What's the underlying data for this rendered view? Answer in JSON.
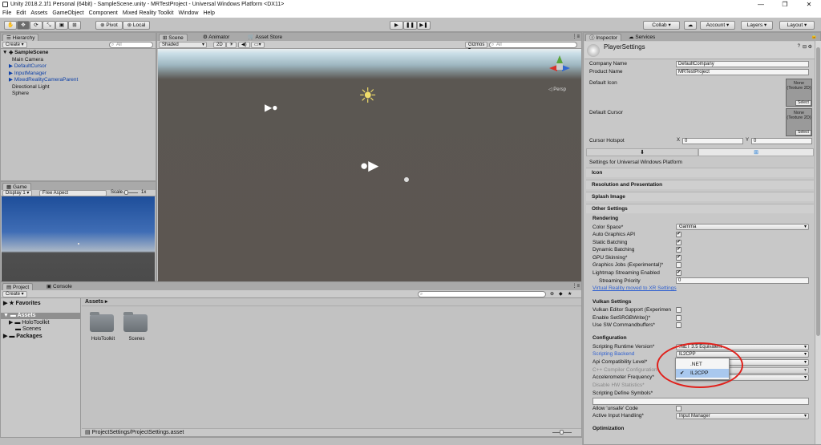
{
  "window": {
    "title": "Unity 2018.2.1f1 Personal (64bit) - SampleScene.unity - MRTestProject - Universal Windows Platform <DX11>",
    "minimize": "—",
    "maximize": "❐",
    "close": "✕"
  },
  "menu": [
    "File",
    "Edit",
    "Assets",
    "GameObject",
    "Component",
    "Mixed Reality Toolkit",
    "Window",
    "Help"
  ],
  "toolbar": {
    "pivot": "Pivot",
    "local": "Local",
    "collab": "Collab ▾",
    "account": "Account",
    "layers": "Layers",
    "layout": "Layout"
  },
  "hierarchy": {
    "tab": "Hierarchy",
    "create": "Create ▾",
    "search_placeholder": "All",
    "scene": "SampleScene",
    "items": [
      {
        "label": "Main Camera",
        "arrow": "",
        "color": "normal"
      },
      {
        "label": "DefaultCursor",
        "arrow": "▶",
        "color": "blue"
      },
      {
        "label": "InputManager",
        "arrow": "▶",
        "color": "blue"
      },
      {
        "label": "MixedRealityCameraParent",
        "arrow": "▶",
        "color": "blue"
      },
      {
        "label": "Directional Light",
        "arrow": "",
        "color": "normal"
      },
      {
        "label": "Sphere",
        "arrow": "",
        "color": "normal"
      }
    ]
  },
  "scene": {
    "tabs": [
      "Scene",
      "Animator",
      "Asset Store"
    ],
    "shaded": "Shaded",
    "mode_2d": "2D",
    "gizmos": "Gizmos ▾",
    "search": "All",
    "persp": "◁ Persp"
  },
  "game": {
    "tab": "Game",
    "display": "Display 1",
    "aspect": "Free Aspect",
    "scale_label": "Scale",
    "scale_value": "1x"
  },
  "project": {
    "tabs": [
      "Project",
      "Console"
    ],
    "create": "Create ▾",
    "favorites": "Favorites",
    "assets_root": "Assets",
    "tree": [
      "HoloToolkit",
      "Scenes"
    ],
    "packages": "Packages",
    "breadcrumb": "Assets ▸",
    "folders": [
      "HoloToolkit",
      "Scenes"
    ],
    "status_path": "ProjectSettings/ProjectSettings.asset",
    "counter": "12"
  },
  "inspector": {
    "tabs": [
      "Inspector",
      "Services"
    ],
    "title": "PlayerSettings",
    "company_label": "Company Name",
    "company_value": "DefaultCompany",
    "product_label": "Product Name",
    "product_value": "MRTestProject",
    "icon_label": "Default Icon",
    "cursor_label": "Default Cursor",
    "texture_none": "None (Texture 2D)",
    "select": "Select",
    "hotspot_label": "Cursor Hotspot",
    "hotspot_x": "X",
    "hotspot_x_val": "0",
    "hotspot_y": "Y",
    "hotspot_y_val": "0",
    "settings_for": "Settings for Universal Windows Platform",
    "foldouts": [
      "Icon",
      "Resolution and Presentation",
      "Splash Image",
      "Other Settings"
    ],
    "rendering": "Rendering",
    "color_space_label": "Color Space*",
    "color_space_value": "Gamma",
    "auto_graphics": "Auto Graphics API",
    "static_batching": "Static Batching",
    "dynamic_batching": "Dynamic Batching",
    "gpu_skinning": "GPU Skinning*",
    "graphics_jobs": "Graphics Jobs (Experimental)*",
    "lightmap_streaming": "Lightmap Streaming Enabled",
    "streaming_priority": "Streaming Priority",
    "streaming_priority_val": "0",
    "vr_link": "Virtual Reality moved to XR Settings",
    "vulkan": "Vulkan Settings",
    "vulkan_editor": "Vulkan Editor Support (Experimen",
    "srgb_write": "Enable SetSRGBWrite()*",
    "sw_cmd": "Use SW Commandbuffers*",
    "configuration": "Configuration",
    "runtime_label": "Scripting Runtime Version*",
    "runtime_value": ".NET 3.5 Equivalent",
    "backend_label": "Scripting Backend",
    "backend_value": "IL2CPP",
    "api_label": "Api Compatibility Level*",
    "cpp_label": "C++ Compiler Configuration",
    "accel_label": "Accelerometer Frequency*",
    "hw_stats": "Disable HW Statistics*",
    "define_symbols": "Scripting Define Symbols*",
    "unsafe": "Allow 'unsafe' Code",
    "input_label": "Active Input Handling*",
    "input_value": "Input Manager",
    "optimization": "Optimization",
    "popup_options": [
      ".NET",
      "IL2CPP"
    ],
    "popup_selected": "IL2CPP"
  },
  "colors": {
    "annotation": "#e0201b",
    "selection": "#3d7cd6",
    "link": "#2e5fd0"
  }
}
